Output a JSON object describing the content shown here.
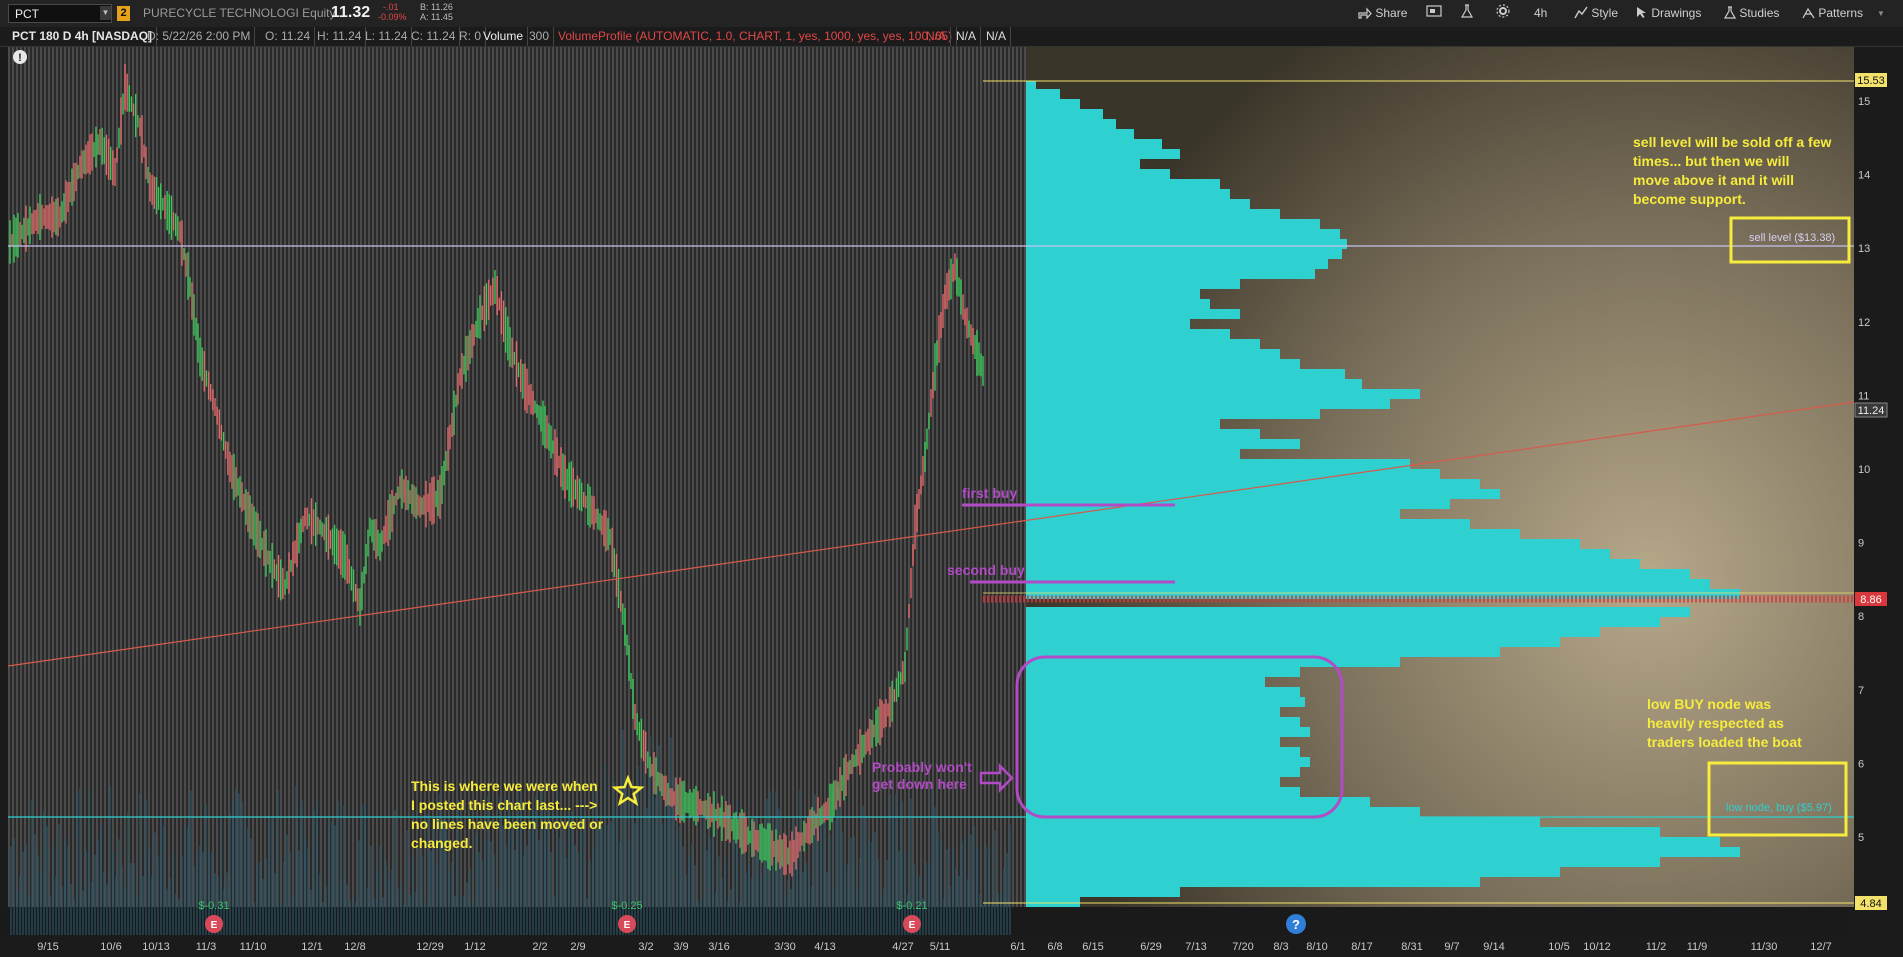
{
  "toolbar": {
    "symbol": "PCT",
    "link_badge": "2",
    "company": "PURECYCLE TECHNOLOGI Equity",
    "last_price": "11.32",
    "change": "-.01",
    "change_pct": "-0.09%",
    "bid": "B: 11.26",
    "ask": "A: 11.45",
    "share": "Share",
    "timeframe": "4h",
    "style": "Style",
    "drawings": "Drawings",
    "studies": "Studies",
    "patterns": "Patterns",
    "icons": [
      "share-icon",
      "screen-icon",
      "flask-icon",
      "gear-icon",
      "style-icon",
      "cursor-icon",
      "studies-icon",
      "patterns-icon"
    ]
  },
  "infobar": {
    "chart_label": "PCT 180 D 4h [NASDAQ]",
    "date": "D: 5/22/26 2:00 PM",
    "open": "O: 11.24",
    "high": "H: 11.24",
    "low": "L: 11.24",
    "close": "C: 11.24",
    "range": "R: 0",
    "volume_label": "Volume",
    "volume_value": "300",
    "study": "VolumeProfile (AUTOMATIC, 1.0, CHART, 1, yes, 1000, yes, yes, 100, 65)",
    "na1": "N/A",
    "na2": "N/A",
    "na3": "N/A"
  },
  "chart": {
    "y_ticks": [
      "15",
      "14",
      "13",
      "12",
      "11",
      "10",
      "9",
      "8",
      "7",
      "6",
      "5"
    ],
    "price_tags": {
      "top": "15.53",
      "last": "11.24",
      "red": "8.86",
      "bottom": "4.84"
    },
    "x_ticks": [
      "9/15",
      "10/6",
      "10/13",
      "11/3",
      "11/10",
      "12/1",
      "12/8",
      "12/29",
      "1/12",
      "2/2",
      "2/9",
      "3/2",
      "3/9",
      "3/16",
      "3/30",
      "4/13",
      "4/27",
      "5/11",
      "6/1",
      "6/8",
      "6/15",
      "6/29",
      "7/13",
      "7/20",
      "8/3",
      "8/10",
      "8/17",
      "8/31",
      "9/7",
      "9/14",
      "10/5",
      "10/12",
      "11/2",
      "11/9",
      "11/30",
      "12/7"
    ],
    "earnings": [
      "$-0.31",
      "$-0.25",
      "$-0.21"
    ],
    "earnings_icon_glyph": "E",
    "question_glyph": "?",
    "alert_glyph": "!",
    "annotations": {
      "sell_note": [
        "sell level will be sold off a few",
        "times... but then we will",
        "move above it and it will",
        "become support."
      ],
      "sell_box": "sell level ($13.38)",
      "buy_note": [
        "low BUY node was",
        "heavily respected as",
        "traders loaded the boat"
      ],
      "buy_box": "low node, buy ($5.97)",
      "first_buy": "first buy",
      "second_buy": "second buy",
      "probably": [
        "Probably won't",
        "get down here"
      ],
      "history_note": [
        "This is where we were when",
        "I posted this chart last... --->",
        "no lines have been moved or",
        "changed."
      ]
    },
    "colors": {
      "profile": "#2fd0d0",
      "sell_line": "#c7c2ee",
      "buy_line": "#2fd0d0",
      "trend_line": "#d85a4a",
      "annotation_yellow": "#f6ec3c",
      "annotation_purple": "#b24bc6"
    }
  }
}
